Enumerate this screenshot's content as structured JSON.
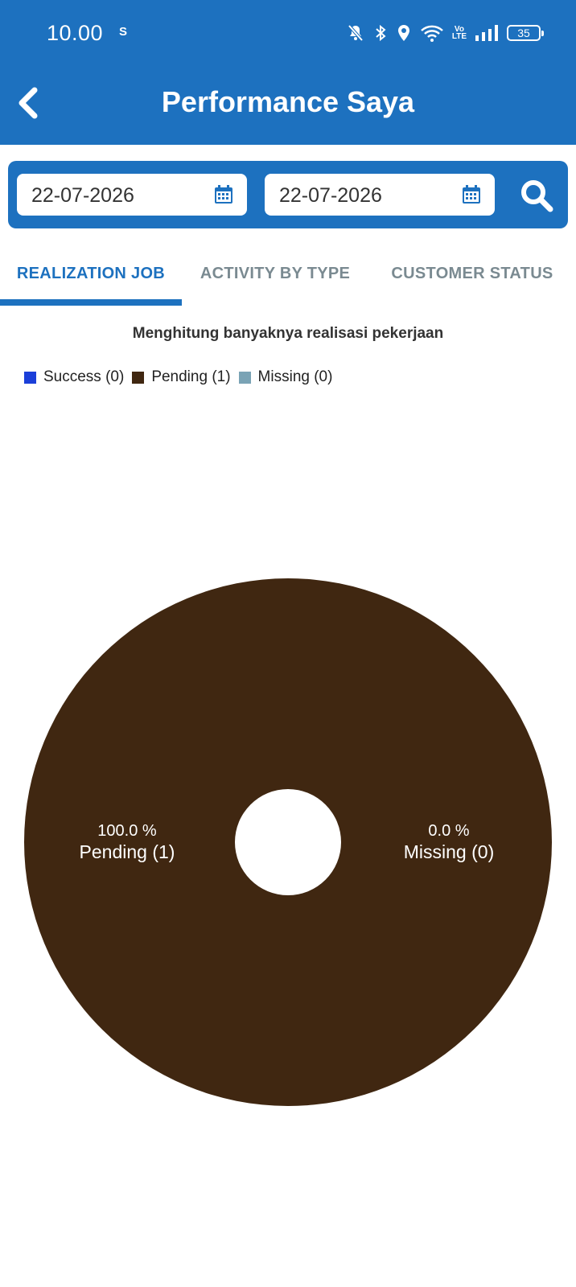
{
  "status_bar": {
    "time": "10.00",
    "sync_icon": "S",
    "volte": "Vo\nLTE",
    "battery": "35"
  },
  "app_bar": {
    "title": "Performance Saya"
  },
  "filters": {
    "start_date": "22-07-2026",
    "end_date": "22-07-2026"
  },
  "tabs": [
    {
      "label": "REALIZATION JOB",
      "active": true
    },
    {
      "label": "ACTIVITY BY TYPE",
      "active": false
    },
    {
      "label": "CUSTOMER STATUS",
      "active": false
    }
  ],
  "chart_description": "Menghitung banyaknya realisasi pekerjaan",
  "legend": [
    {
      "label": "Success (0)",
      "color": "#1b3fd9"
    },
    {
      "label": "Pending (1)",
      "color": "#402711"
    },
    {
      "label": "Missing (0)",
      "color": "#7aa3b5"
    }
  ],
  "colors": {
    "primary": "#1d71bf",
    "tab_inactive": "#7a8a91"
  },
  "chart_data": {
    "type": "pie",
    "donut": true,
    "categories": [
      "Success",
      "Pending",
      "Missing"
    ],
    "values": [
      0,
      1,
      0
    ],
    "colors": [
      "#1b3fd9",
      "#402711",
      "#7aa3b5"
    ],
    "labels": [
      {
        "percent": "0.0 %",
        "name": "Success (0)"
      },
      {
        "percent": "100.0 %",
        "name": "Pending (1)"
      },
      {
        "percent": "0.0 %",
        "name": "Missing (0)"
      }
    ]
  }
}
